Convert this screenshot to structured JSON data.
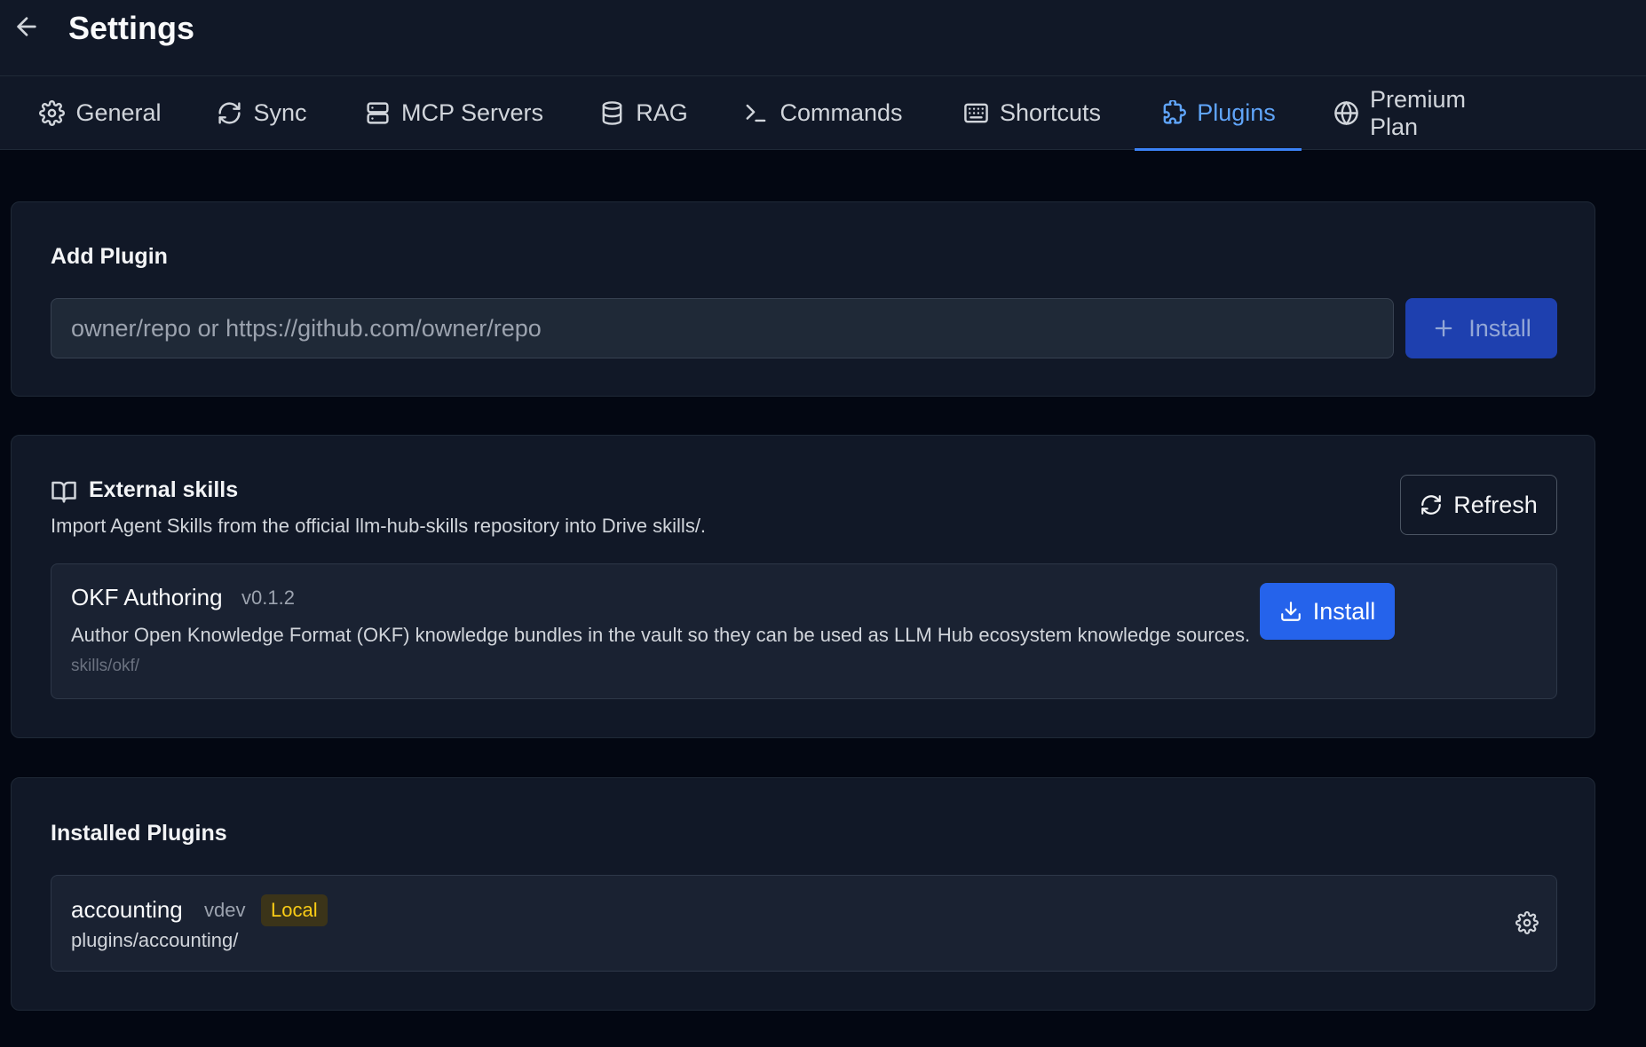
{
  "header": {
    "title": "Settings",
    "back_icon": "arrow-left-icon"
  },
  "tabs": [
    {
      "label": "General",
      "icon": "gear-icon",
      "active": false
    },
    {
      "label": "Sync",
      "icon": "refresh-icon",
      "active": false
    },
    {
      "label": "MCP Servers",
      "icon": "server-icon",
      "active": false
    },
    {
      "label": "RAG",
      "icon": "database-icon",
      "active": false
    },
    {
      "label": "Commands",
      "icon": "terminal-icon",
      "active": false
    },
    {
      "label": "Shortcuts",
      "icon": "keyboard-icon",
      "active": false
    },
    {
      "label": "Plugins",
      "icon": "puzzle-icon",
      "active": true
    },
    {
      "label": "Premium Plan",
      "icon": "globe-icon",
      "active": false
    }
  ],
  "add_plugin": {
    "title": "Add Plugin",
    "input_value": "",
    "input_placeholder": "owner/repo or https://github.com/owner/repo",
    "install_label": "Install"
  },
  "external_skills": {
    "title": "External skills",
    "description": "Import Agent Skills from the official llm-hub-skills repository into Drive skills/.",
    "refresh_label": "Refresh",
    "items": [
      {
        "name": "OKF Authoring",
        "version": "v0.1.2",
        "description": "Author Open Knowledge Format (OKF) knowledge bundles in the vault so they can be used as LLM Hub ecosystem knowledge sources.",
        "path": "skills/okf/",
        "install_label": "Install"
      }
    ]
  },
  "installed_plugins": {
    "title": "Installed Plugins",
    "items": [
      {
        "name": "accounting",
        "version": "vdev",
        "badge": "Local",
        "path": "plugins/accounting/"
      }
    ]
  },
  "colors": {
    "background": "#030712",
    "surface": "#111827",
    "accent": "#3b82f6",
    "badge_local": "#facc15"
  }
}
